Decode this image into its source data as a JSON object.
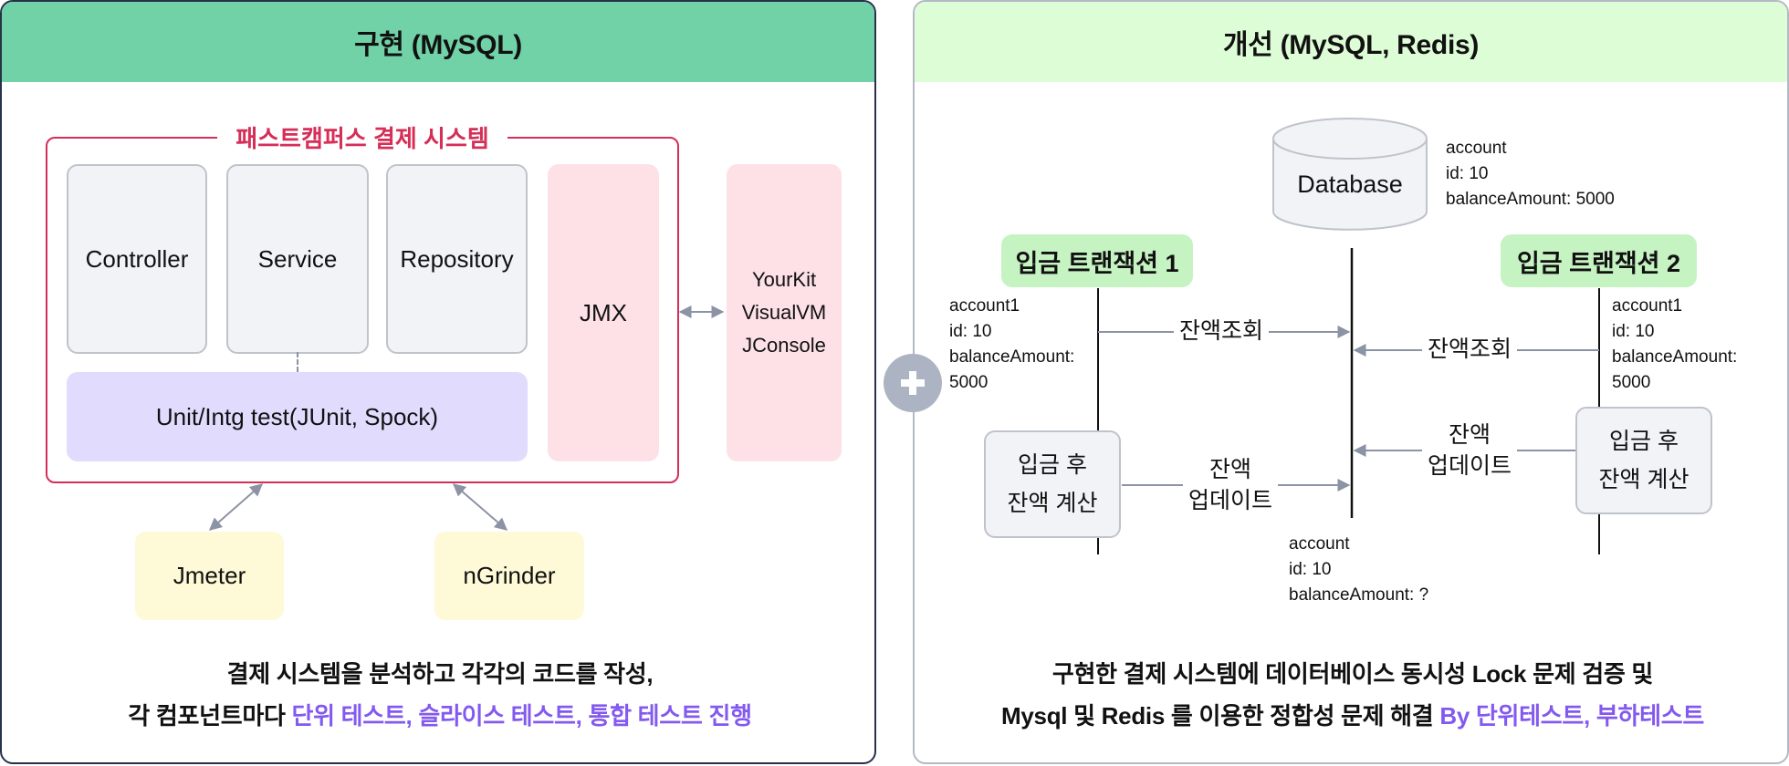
{
  "left_panel": {
    "title": "구현 (MySQL)",
    "system_title": "패스트캠퍼스 결제 시스템",
    "components": {
      "controller": "Controller",
      "service": "Service",
      "repository": "Repository",
      "test": "Unit/Intg test(JUnit, Spock)",
      "jmx": "JMX",
      "profilers": [
        "YourKit",
        "VisualVM",
        "JConsole"
      ],
      "jmeter": "Jmeter",
      "ngrinder": "nGrinder"
    },
    "caption": {
      "line1": "결제 시스템을 분석하고 각각의 코드를 작성,",
      "line2_plain": "각 컴포넌트마다 ",
      "line2_accent": "단위 테스트, 슬라이스 테스트, 통합 테스트 진행"
    }
  },
  "right_panel": {
    "title": "개선 (MySQL, Redis)",
    "database": {
      "label": "Database",
      "info": [
        "account",
        "id: 10",
        "balanceAmount: 5000"
      ]
    },
    "transaction1": {
      "title": "입금 트랜잭션 1",
      "info": [
        "account1",
        "id: 10",
        "balanceAmount:",
        "5000"
      ],
      "calc": [
        "입금 후",
        "잔액 계산"
      ],
      "read_msg": "잔액조회",
      "update_msg": [
        "잔액",
        "업데이트"
      ]
    },
    "transaction2": {
      "title": "입금 트랜잭션 2",
      "info": [
        "account1",
        "id: 10",
        "balanceAmount:",
        "5000"
      ],
      "calc": [
        "입금 후",
        "잔액 계산"
      ],
      "read_msg": "잔액조회",
      "update_msg": [
        "잔액",
        "업데이트"
      ]
    },
    "result_info": [
      "account",
      "id: 10",
      "balanceAmount: ?"
    ],
    "caption": {
      "line1": "구현한 결제 시스템에 데이터베이스 동시성 Lock 문제 검증 및",
      "line2_plain": "Mysql 및 Redis 를 이용한 정합성 문제 해결 ",
      "line2_accent": "By 단위테스트, 부하테스트"
    }
  },
  "connector": {
    "icon": "plus-icon"
  },
  "colors": {
    "left_header": "#71d2a8",
    "right_header": "#ddfdd6",
    "system_frame": "#d52e57",
    "accent_text": "#8359ef",
    "transaction_header": "#c6f3c2",
    "arrow": "#8b93a4"
  }
}
